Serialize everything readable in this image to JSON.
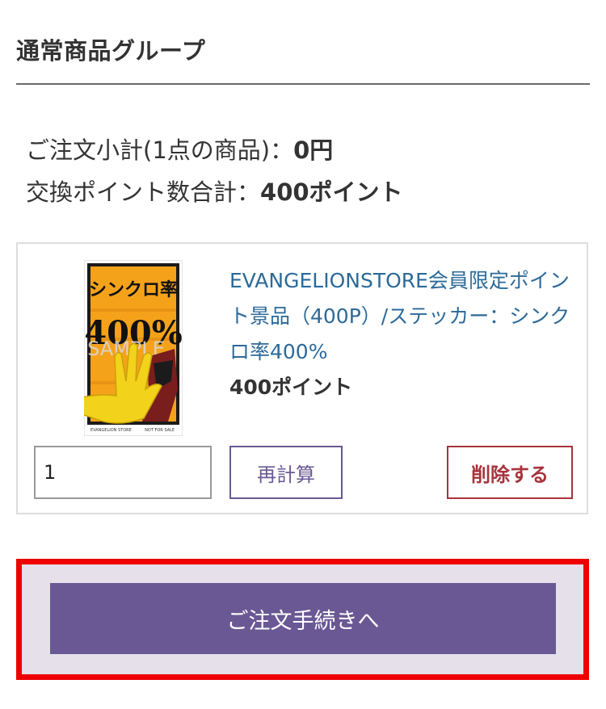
{
  "section": {
    "title": "通常商品グループ"
  },
  "summary": {
    "subtotal_label": "ご注文小計(1点の商品)：",
    "subtotal_value": "0円",
    "points_label": "交換ポイント数合計：",
    "points_value": "400ポイント"
  },
  "item": {
    "name": "EVANGELIONSTORE会員限定ポイント景品（400P）/ステッカー：シンクロ率400%",
    "price": "400ポイント",
    "image": {
      "top_text": "シンクロ率",
      "big_text": "400%",
      "watermark": "SAMPLE",
      "footer_left": "EVANGELION STORE",
      "footer_right": "NOT FOR SALE"
    },
    "quantity": "1",
    "recalc_label": "再計算",
    "delete_label": "削除する"
  },
  "checkout": {
    "label": "ご注文手続きへ"
  },
  "colors": {
    "accent": "#6a5894",
    "link": "#2c6a99",
    "danger": "#a8333c",
    "highlight": "#ee0000"
  }
}
